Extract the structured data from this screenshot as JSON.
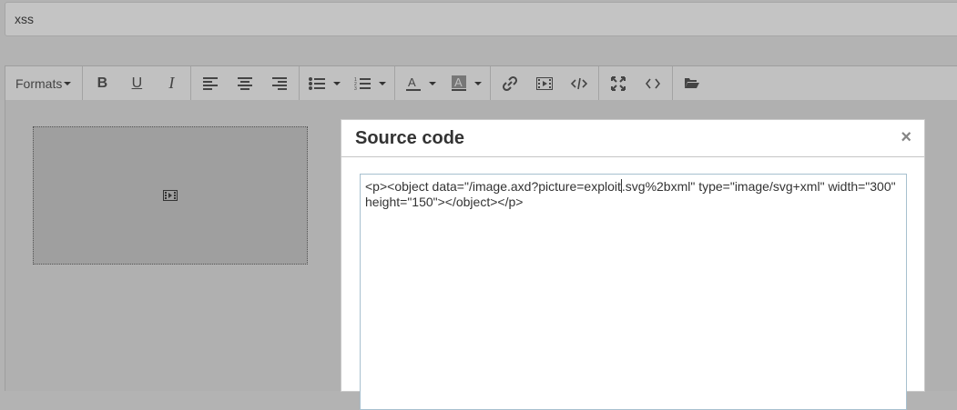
{
  "title_field": {
    "value": "xss"
  },
  "toolbar": {
    "formats_label": "Formats",
    "buttons": {
      "bold": "B",
      "underline": "U",
      "italic": "I"
    }
  },
  "icons": [
    "bold-icon",
    "underline-icon",
    "italic-icon",
    "align-left-icon",
    "align-center-icon",
    "align-right-icon",
    "bullet-list-icon",
    "numbered-list-icon",
    "text-color-icon",
    "background-color-icon",
    "link-icon",
    "media-icon",
    "code-icon",
    "fullscreen-icon",
    "source-code-icon",
    "folder-open-icon",
    "close-icon"
  ],
  "dialog": {
    "title": "Source code",
    "close_label": "×",
    "code_before_cursor": "<p><object data=\"/image.axd?picture=exploit",
    "code_after_cursor": ".svg%2bxml\" type=\"image/svg+xml\" width=\"300\" height=\"150\"></object></p>"
  }
}
